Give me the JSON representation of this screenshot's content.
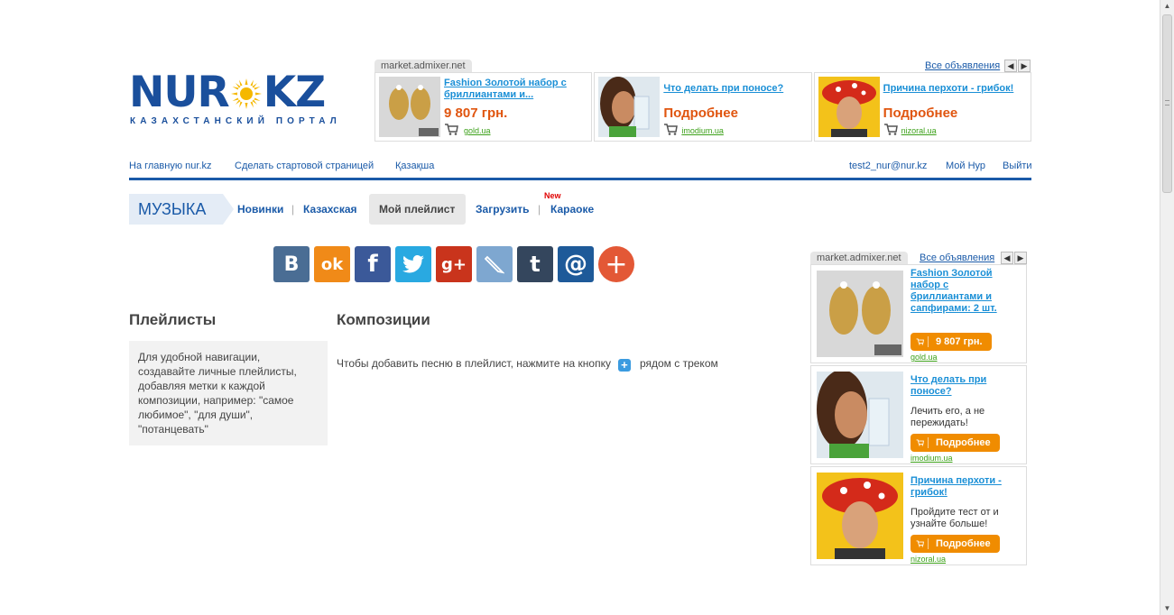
{
  "logo": {
    "word_left": "NUR",
    "word_right": "KZ",
    "tagline": "КАЗАХСТАНСКИЙ ПОРТАЛ"
  },
  "ad_top": {
    "label": "market.admixer.net",
    "all_link": "Все объявления",
    "prev_icon": "chevron-left",
    "next_icon": "chevron-right",
    "items": [
      {
        "title": "Fashion Золотой набор с бриллиантами и...",
        "price": "9 807 грн.",
        "domain": "gold.ua"
      },
      {
        "title": "Что делать при поносе?",
        "more": "Подробнее",
        "domain": "imodium.ua"
      },
      {
        "title": "Причина перхоти - грибок!",
        "more": "Подробнее",
        "domain": "nizoral.ua"
      }
    ]
  },
  "topnav": {
    "home": "На главную nur.kz",
    "start_page": "Сделать стартовой страницей",
    "kazakh": "Қазақша",
    "email": "test2_nur@nur.kz",
    "my_nur": "Мой Нур",
    "logout": "Выйти"
  },
  "section": {
    "tag": "МУЗЫКА",
    "menu": {
      "new": "Новинки",
      "kazakh": "Казахская",
      "playlist": "Мой плейлист",
      "upload": "Загрузить",
      "karaoke": "Караоке",
      "new_badge": "New"
    }
  },
  "social": {
    "vk": "В",
    "ok": "ok",
    "fb": "f",
    "tw": "twitter-icon",
    "gp": "g+",
    "lj": "livejournal-icon",
    "tumblr": "t",
    "mail": "@",
    "more": "+"
  },
  "content": {
    "playlists_heading": "Плейлисты",
    "compositions_heading": "Композиции",
    "info": "Для удобной навигации, создавайте личные плейлисты, добавляя метки к каждой композиции, например: \"самое любимое\", \"для души\", \"потанцевать\"",
    "hint_before": "Чтобы добавить песню в плейлист, нажмите на кнопку",
    "hint_after": "рядом с треком"
  },
  "ad_right": {
    "label": "market.admixer.net",
    "all_link": "Все объявления",
    "items": [
      {
        "title": "Fashion Золотой набор с бриллиантами и сапфирами: 2 шт.",
        "button": "9 807 грн.",
        "domain": "gold.ua"
      },
      {
        "title": "Что делать при поносе?",
        "desc": "Лечить его, а не пережидать!",
        "button": "Подробнее",
        "domain": "imodium.ua"
      },
      {
        "title": "Причина перхоти - грибок!",
        "desc": "Пройдите тест от и узнайте больше!",
        "button": "Подробнее",
        "domain": "nizoral.ua"
      }
    ]
  },
  "colors": {
    "brand_blue": "#1a5aa8",
    "ad_link": "#1a8fd6",
    "price_orange": "#e0550f",
    "button_orange": "#f08c00",
    "domain_green": "#3da11a"
  }
}
